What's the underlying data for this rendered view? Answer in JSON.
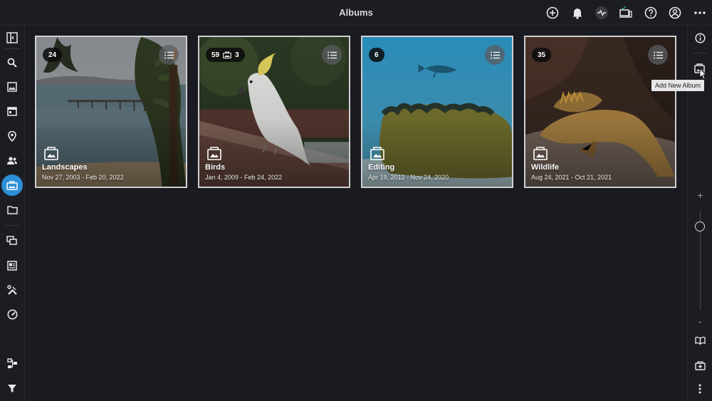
{
  "header": {
    "title": "Albums",
    "icons": [
      "add-circle-icon",
      "bell-icon",
      "activity-icon",
      "devices-icon",
      "help-icon",
      "account-icon",
      "more-icon"
    ]
  },
  "left_sidebar": {
    "items": [
      "sidebar-toggle-icon",
      "search-icon",
      "photos-icon",
      "calendar-icon",
      "places-icon",
      "people-icon",
      "albums-icon",
      "folders-icon",
      "tags-icon",
      "moments-icon",
      "tools-icon",
      "dashboard-icon",
      "workflow-icon",
      "filter-icon"
    ],
    "active": "albums-icon"
  },
  "right_sidebar": {
    "items": [
      "info-icon",
      "add-album-icon",
      "zoom-in",
      "zoom-out",
      "book-icon",
      "export-icon",
      "more-vertical-icon"
    ],
    "zoom_plus": "+",
    "zoom_minus": "-",
    "tooltip": "Add New Album"
  },
  "albums": [
    {
      "name": "Landscapes",
      "dates": "Nov 27, 2003 - Feb 20, 2022",
      "count": "24",
      "sub_count": ""
    },
    {
      "name": "Birds",
      "dates": "Jan 4, 2009 - Feb 24, 2022",
      "count": "59",
      "sub_count": "3"
    },
    {
      "name": "Editing",
      "dates": "Apr 19, 2012 - Nov 24, 2020",
      "count": "6",
      "sub_count": ""
    },
    {
      "name": "Wildlife",
      "dates": "Aug 24, 2021 - Oct 21, 2021",
      "count": "35",
      "sub_count": ""
    }
  ],
  "colors": {
    "accent": "#2d8fd6",
    "background": "#1a1b20",
    "panel": "#1c1d22"
  }
}
